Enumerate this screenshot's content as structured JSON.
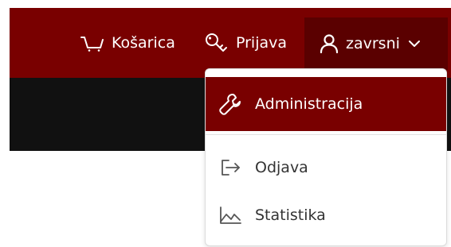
{
  "navbar": {
    "cart_label": "Košarica",
    "login_label": "Prijava",
    "user_label": "zavrsni"
  },
  "user_menu": {
    "items": [
      {
        "label": "Administracija",
        "icon": "wrench-icon",
        "active": true
      },
      {
        "label": "Odjava",
        "icon": "logout-icon",
        "active": false
      },
      {
        "label": "Statistika",
        "icon": "chart-line-icon",
        "active": false
      }
    ]
  },
  "colors": {
    "navbar_bg": "#790000",
    "user_item_bg": "#5a0000",
    "active_item_bg": "#790000",
    "dark_band": "#111111"
  }
}
